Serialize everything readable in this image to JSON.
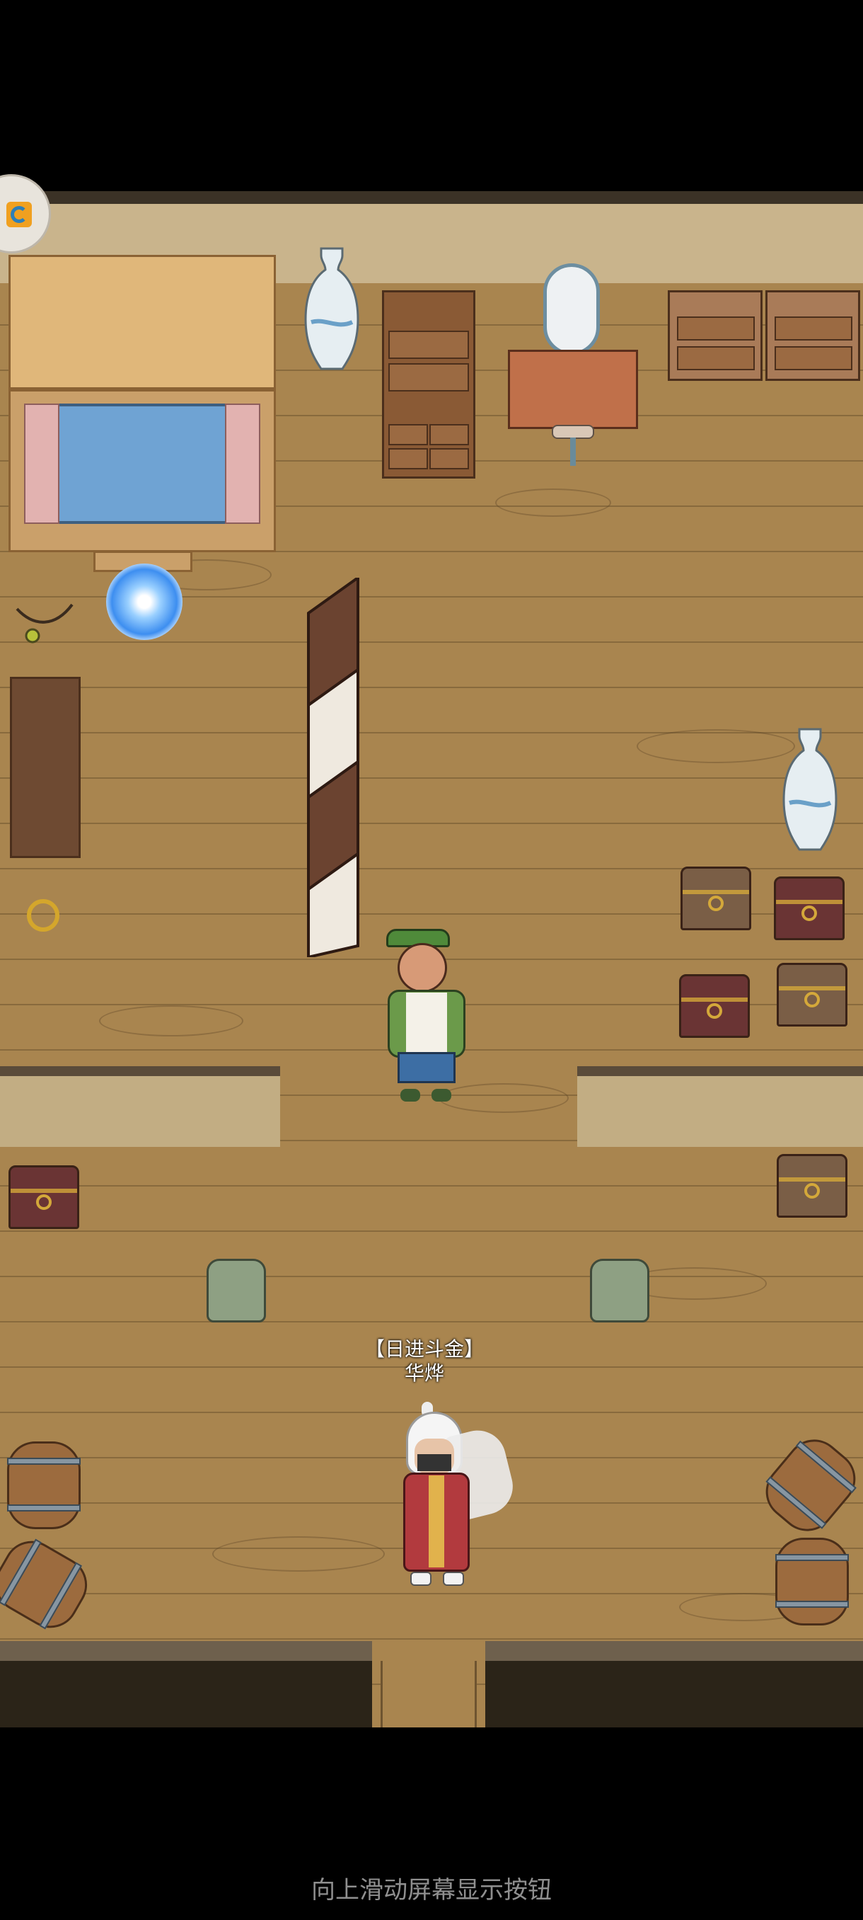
{
  "player": {
    "title": "【日进斗金】",
    "name": "华烨"
  },
  "hint": {
    "text": "向上滑动屏幕显示按钮"
  },
  "icons": {
    "menu": "menu-bubble-icon",
    "portal": "swirl-portal-icon",
    "necklace": "necklace-icon",
    "ring": "ring-icon"
  },
  "colors": {
    "floor": "#a9854f",
    "wall": "#c9b48c",
    "background": "#000000",
    "hint_text": "#8f8f8f"
  }
}
